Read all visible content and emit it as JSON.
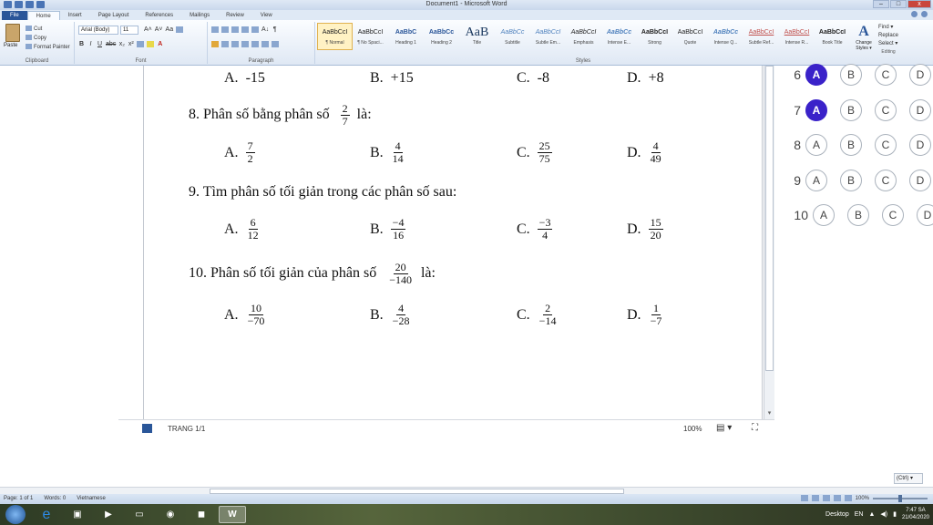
{
  "window": {
    "title": "Document1 - Microsoft Word",
    "min": "–",
    "max": "□",
    "close": "x"
  },
  "tabs": [
    "File",
    "Home",
    "Insert",
    "Page Layout",
    "References",
    "Mailings",
    "Review",
    "View"
  ],
  "clipboard": {
    "paste": "Paste",
    "cut": "Cut",
    "copy": "Copy",
    "format_painter": "Format Painter",
    "label": "Clipboard"
  },
  "font": {
    "name": "Arial (Body)",
    "size": "11",
    "label": "Font",
    "grow": "A˄",
    "shrink": "A˅",
    "case": "Aa",
    "bold": "B",
    "italic": "I",
    "underline": "U",
    "strike": "abc",
    "subscript": "x₂",
    "superscript": "x²",
    "color": "A"
  },
  "paragraph": {
    "label": "Paragraph",
    "pilcrow": "¶",
    "sort": "A↓"
  },
  "styles": {
    "label": "Styles",
    "items": [
      {
        "preview": "AaBbCcI",
        "name": "¶ Normal"
      },
      {
        "preview": "AaBbCcI",
        "name": "¶ No Spaci..."
      },
      {
        "preview": "AaBbC",
        "name": "Heading 1"
      },
      {
        "preview": "AaBbCc",
        "name": "Heading 2"
      },
      {
        "preview": "AaB",
        "name": "Title"
      },
      {
        "preview": "AaBbCc",
        "name": "Subtitle"
      },
      {
        "preview": "AaBbCcI",
        "name": "Subtle Em..."
      },
      {
        "preview": "AaBbCcI",
        "name": "Emphasis"
      },
      {
        "preview": "AaBbCc",
        "name": "Intense E..."
      },
      {
        "preview": "AaBbCcI",
        "name": "Strong"
      },
      {
        "preview": "AaBbCcI",
        "name": "Quote"
      },
      {
        "preview": "AaBbCc",
        "name": "Intense Q..."
      },
      {
        "preview": "AaBbCcI",
        "name": "Subtle Ref..."
      },
      {
        "preview": "AaBbCcI",
        "name": "Intense R..."
      },
      {
        "preview": "AaBbCcI",
        "name": "Book Title"
      }
    ],
    "change_styles": "Change Styles ▾",
    "change_styles_glyph": "A"
  },
  "editing": {
    "find": "Find ▾",
    "replace": "Replace",
    "select": "Select ▾",
    "label": "Editing"
  },
  "document": {
    "questions": [
      {
        "stem": "",
        "options": [
          {
            "letter": "A.",
            "text": "-15"
          },
          {
            "letter": "B.",
            "text": "+15"
          },
          {
            "letter": "C.",
            "text": "-8"
          },
          {
            "letter": "D.",
            "text": "+8"
          }
        ]
      },
      {
        "stem": "8. Phân số bằng phân số",
        "stem_frac": {
          "num": "2",
          "den": "7"
        },
        "stem_suffix": "là:",
        "options": [
          {
            "letter": "A.",
            "num": "7",
            "den": "2"
          },
          {
            "letter": "B.",
            "num": "4",
            "den": "14"
          },
          {
            "letter": "C.",
            "num": "25",
            "den": "75"
          },
          {
            "letter": "D.",
            "num": "4",
            "den": "49"
          }
        ]
      },
      {
        "stem": "9. Tìm phân số tối giản trong các phân số sau:",
        "options": [
          {
            "letter": "A.",
            "num": "6",
            "den": "12"
          },
          {
            "letter": "B.",
            "num": "−4",
            "den": "16"
          },
          {
            "letter": "C.",
            "num": "−3",
            "den": "4"
          },
          {
            "letter": "D.",
            "num": "15",
            "den": "20"
          }
        ]
      },
      {
        "stem": "10. Phân số tối giản của phân số",
        "stem_frac": {
          "num": "20",
          "den": "−140"
        },
        "stem_suffix": "là:",
        "options": [
          {
            "letter": "A.",
            "num": "10",
            "den": "−70"
          },
          {
            "letter": "B.",
            "num": "4",
            "den": "−28"
          },
          {
            "letter": "C.",
            "num": "2",
            "den": "−14"
          },
          {
            "letter": "D.",
            "num": "1",
            "den": "−7"
          }
        ]
      }
    ]
  },
  "answer_sheet": {
    "rows": [
      {
        "num": "6",
        "selected": "A"
      },
      {
        "num": "7",
        "selected": "A"
      },
      {
        "num": "8",
        "selected": ""
      },
      {
        "num": "9",
        "selected": ""
      },
      {
        "num": "10",
        "selected": ""
      }
    ],
    "options": [
      "A",
      "B",
      "C",
      "D"
    ],
    "fill_color": "#3a22c9"
  },
  "footer": {
    "page_label": "TRANG 1/1",
    "zoom": "100%",
    "view_icon": "▤ ▾",
    "fit_icon": "⛶"
  },
  "paste_options": "(Ctrl) ▾",
  "statusbar": {
    "page": "Page: 1 of 1",
    "words": "Words: 0",
    "language": "Vietnamese",
    "zoom": "100%"
  },
  "taskbar": {
    "desktop": "Desktop",
    "lang": "EN",
    "time": "7:47 SA",
    "date": "21/04/2020"
  }
}
